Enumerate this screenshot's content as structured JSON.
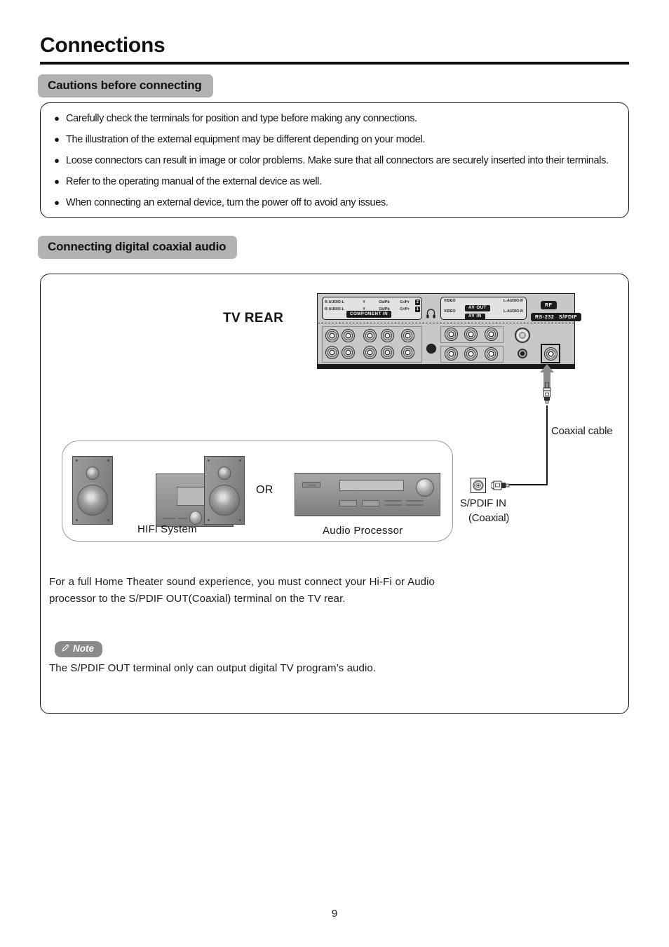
{
  "page": {
    "title": "Connections",
    "number": "9"
  },
  "sections": {
    "cautions": {
      "heading": "Cautions before connecting",
      "bullets": [
        "Carefully check the terminals for position and type before making any connections.",
        "The illustration of the external equipment may be different depending on your model.",
        "Loose connectors can result in image or color problems. Make sure that all connectors are securely inserted into their terminals.",
        "Refer to the operating manual of the external device as well.",
        "When connecting an external device, turn the power off to avoid any issues."
      ]
    },
    "coaxial": {
      "heading": "Connecting digital coaxial audio",
      "tv_rear_label": "TV REAR",
      "panel": {
        "component": {
          "row2": {
            "left": "R-AUDIO-L",
            "y": "Y",
            "cb": "Cb/Pb",
            "cr": "Cr/Pr",
            "num": "2"
          },
          "row1": {
            "left": "R-AUDIO-L",
            "y": "Y",
            "cb": "Cb/Pb",
            "cr": "Cr/Pr",
            "num": "1"
          },
          "tag": "COMPONENT IN"
        },
        "av": {
          "out_video": "VIDEO",
          "out_audio": "L-AUDIO-R",
          "out_tag": "AV OUT",
          "in_video": "VIDEO",
          "in_audio": "L-AUDIO-R",
          "in_tag": "AV IN"
        },
        "rf_tag": "RF",
        "rs232_tag": "RS-232",
        "spdif_tag": "S/PDIF"
      },
      "coaxial_cable_label": "Coaxial cable",
      "spdif_in_label": "S/PDIF IN",
      "spdif_coaxial_label": "(Coaxial)",
      "equipment": {
        "hifi_caption": "HIFi  System",
        "or_label": "OR",
        "processor_caption": "Audio  Processor",
        "power_label": "POWER"
      },
      "paragraph": "For a full Home Theater sound experience, you must connect your Hi-Fi or Audio processor to the S/PDIF OUT(Coaxial) terminal on the TV rear.",
      "note": {
        "badge": "Note",
        "text": "The S/PDIF OUT terminal only can output digital TV program’s audio."
      }
    }
  },
  "colors": {
    "badge_gray": "#b2b2b2",
    "note_gray": "#8a8a8a",
    "panel_gray": "#c8c8c8",
    "ink": "#1a1a1a",
    "arrow_gray": "#8c8c8c"
  }
}
